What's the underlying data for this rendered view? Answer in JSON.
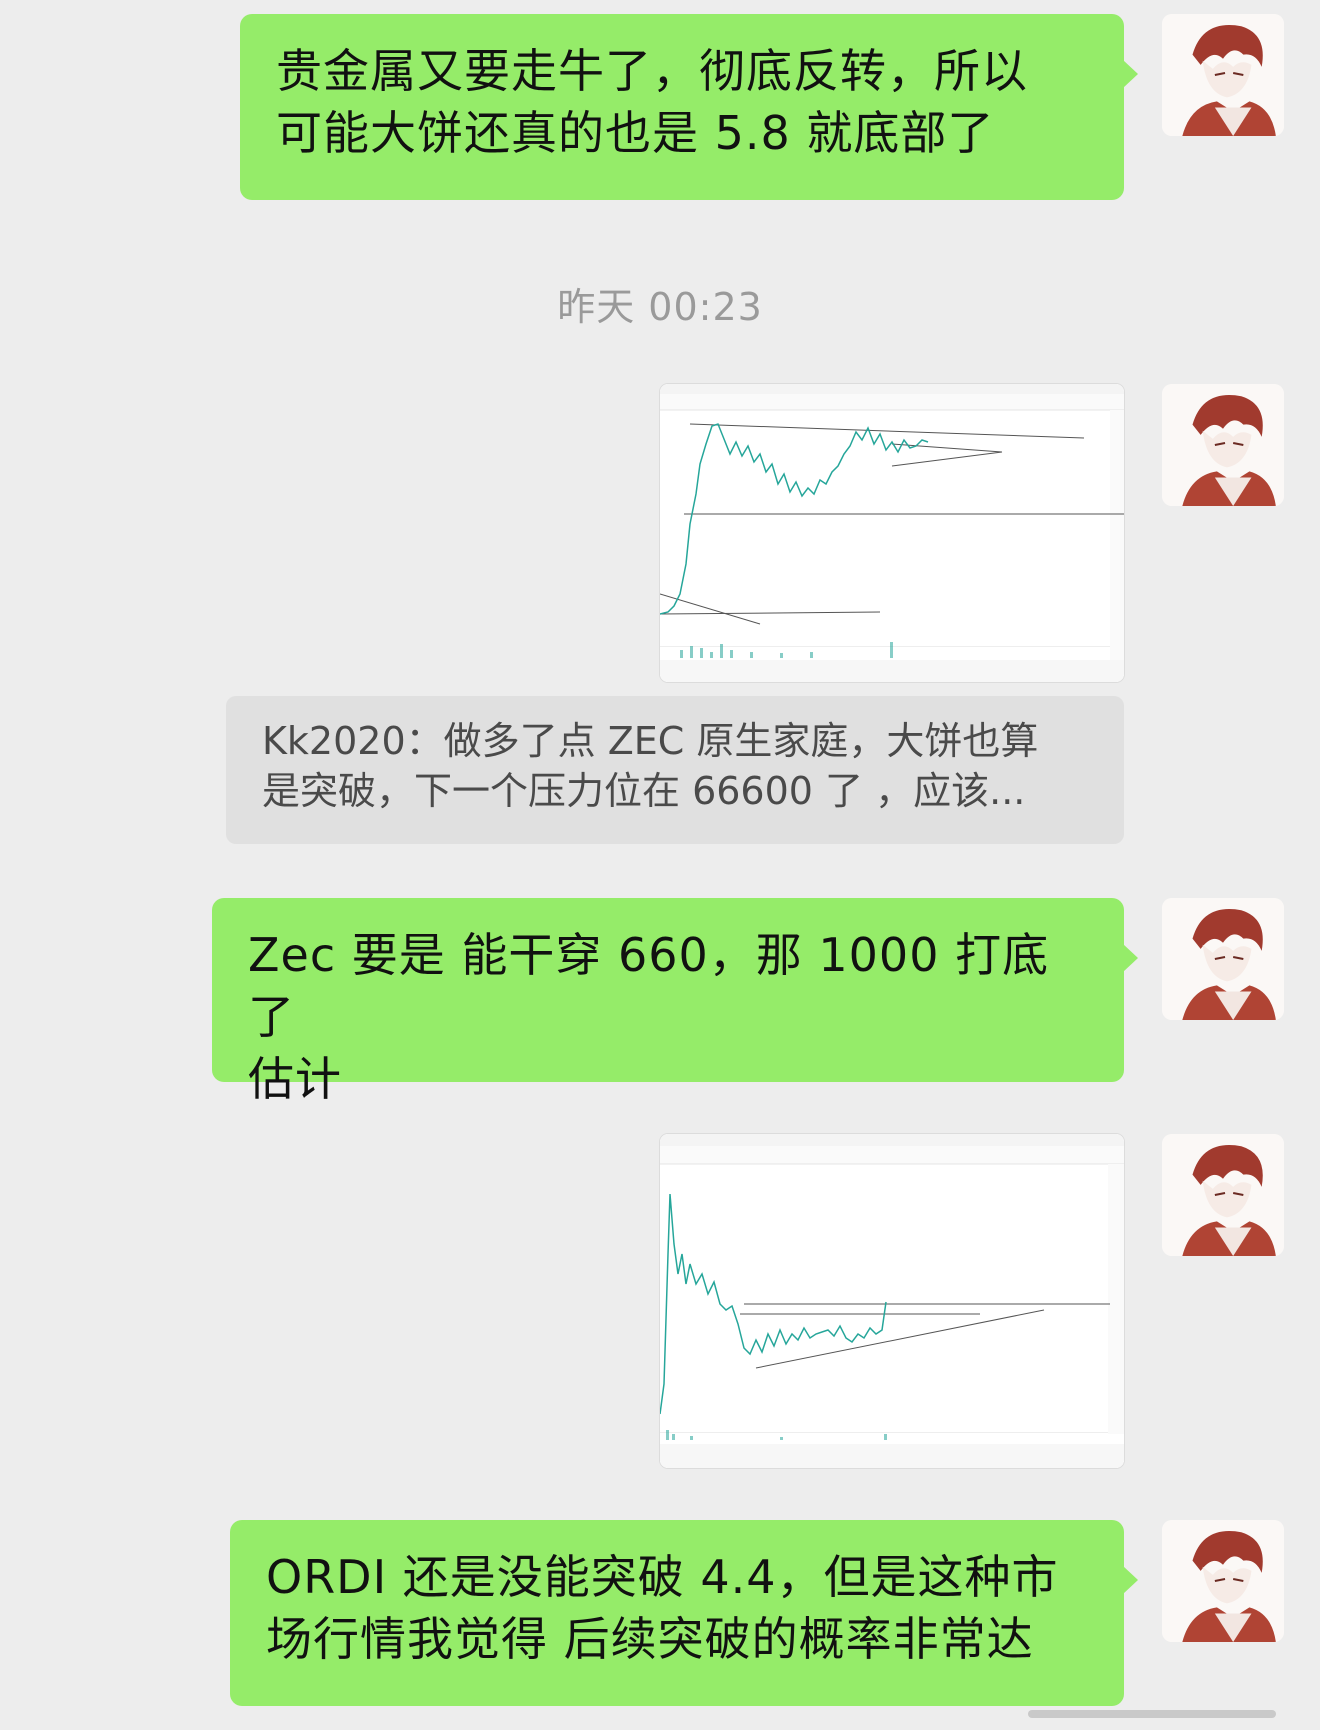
{
  "messages": [
    {
      "type": "text",
      "lines": [
        "贵金属又要走牛了，彻底反转，所以",
        "可能大饼还真的也是 5.8 就底部了"
      ]
    },
    {
      "type": "timestamp",
      "text": "昨天 00:23"
    },
    {
      "type": "image",
      "description": "chart-screenshot-1"
    },
    {
      "type": "quote",
      "lines": [
        "Kk2020：做多了点 ZEC 原生家庭，大饼也算",
        "是突破，下一个压力位在 66600 了 ，应该..."
      ]
    },
    {
      "type": "text",
      "lines": [
        "Zec 要是 能干穿 660，那 1000 打底了",
        "估计"
      ]
    },
    {
      "type": "image",
      "description": "chart-screenshot-2"
    },
    {
      "type": "text",
      "lines": [
        "ORDI 还是没能突破 4.4，但是这种市",
        "场行情我觉得 后续突破的概率非常达"
      ]
    }
  ],
  "colors": {
    "background": "#ededed",
    "self_bubble": "#95ec69",
    "quote_bubble": "#e0e0e0",
    "timestamp_text": "#9a9a9a"
  }
}
